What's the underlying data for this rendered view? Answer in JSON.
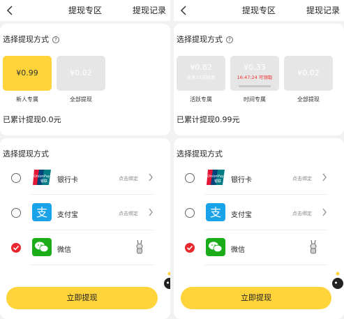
{
  "left": {
    "header": {
      "title": "提现专区",
      "record": "提现记录"
    },
    "section_title": "选择提现方式",
    "help": "?",
    "options": [
      {
        "amount": "¥0.99",
        "label": "新人专属"
      },
      {
        "amount": "¥0.02",
        "label": "全部提现"
      }
    ],
    "total": "已累计提现0.0元",
    "pay_title": "选择提现方式",
    "methods": [
      {
        "name": "银行卡",
        "bind": "点击绑定"
      },
      {
        "name": "支付宝",
        "bind": "点击绑定"
      },
      {
        "name": "微信"
      }
    ],
    "cta": "立即提现"
  },
  "right": {
    "header": {
      "title": "提现专区",
      "record": "提现记录"
    },
    "section_title": "选择提现方式",
    "help": "?",
    "options": [
      {
        "amount": "¥0.82",
        "sub": "还差15活跃度",
        "label": "活跃专属"
      },
      {
        "amount": "¥0.33",
        "sub": "16:47:24 可领取",
        "label": "时间专属"
      },
      {
        "amount": "¥0.02",
        "label": "全部提现"
      }
    ],
    "total": "已累计提现0.99元",
    "pay_title": "选择提现方式",
    "methods": [
      {
        "name": "银行卡",
        "bind": "点击绑定"
      },
      {
        "name": "支付宝",
        "bind": "点击绑定"
      },
      {
        "name": "微信"
      }
    ],
    "cta": "立即提现"
  },
  "icons": {
    "unionpay": "unionpay-icon",
    "alipay": "alipay-icon",
    "wechat": "wechat-icon",
    "unionpay_text": "UnionPay",
    "unionpay_cn": "银联",
    "alipay_char": "支"
  },
  "colors": {
    "accent": "#ffd43b",
    "selected_radio": "#e8272f",
    "alipay": "#1aa3e8",
    "wechat": "#1aad19"
  }
}
